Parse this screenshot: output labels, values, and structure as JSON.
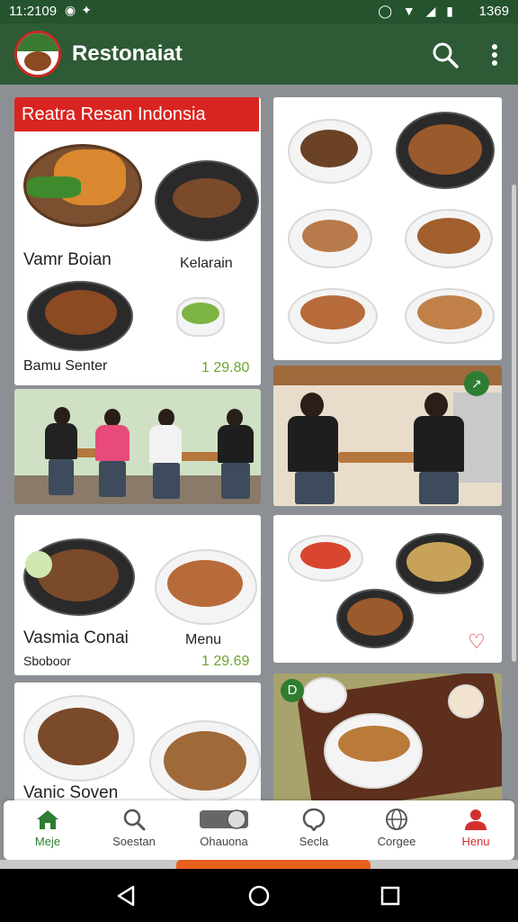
{
  "status_bar": {
    "time": "11:2109",
    "right_time": "1369"
  },
  "app_bar": {
    "title": "Restonaiat",
    "search_icon": "search-icon",
    "more_icon": "more-vert-icon"
  },
  "cards": {
    "c1": {
      "banner": "Reatra Resan Indonsia",
      "label_a": "Vamr Boian",
      "label_b": "Kelarain",
      "label_c": "Bamu Senter",
      "price": "1 29.80"
    },
    "c2": {},
    "c3": {},
    "c4": {},
    "c5": {
      "label_a": "Vasmia Conai",
      "label_b": "Menu",
      "label_c": "Sboboor",
      "price": "1 29.69"
    },
    "c6": {},
    "c7": {
      "label_a": "Vanic Soven"
    },
    "c8": {
      "badge": "D"
    }
  },
  "bottom_nav": [
    {
      "label": "Meje",
      "icon": "home-icon"
    },
    {
      "label": "Soestan",
      "icon": "search-icon"
    },
    {
      "label": "Ohauona",
      "icon": "toggle-icon"
    },
    {
      "label": "Secla",
      "icon": "chat-icon"
    },
    {
      "label": "Corgee",
      "icon": "globe-icon"
    },
    {
      "label": "Henu",
      "icon": "person-icon"
    }
  ],
  "colors": {
    "primary": "#2e5a35",
    "accent_red": "#d92521",
    "price_green": "#6da52f"
  }
}
